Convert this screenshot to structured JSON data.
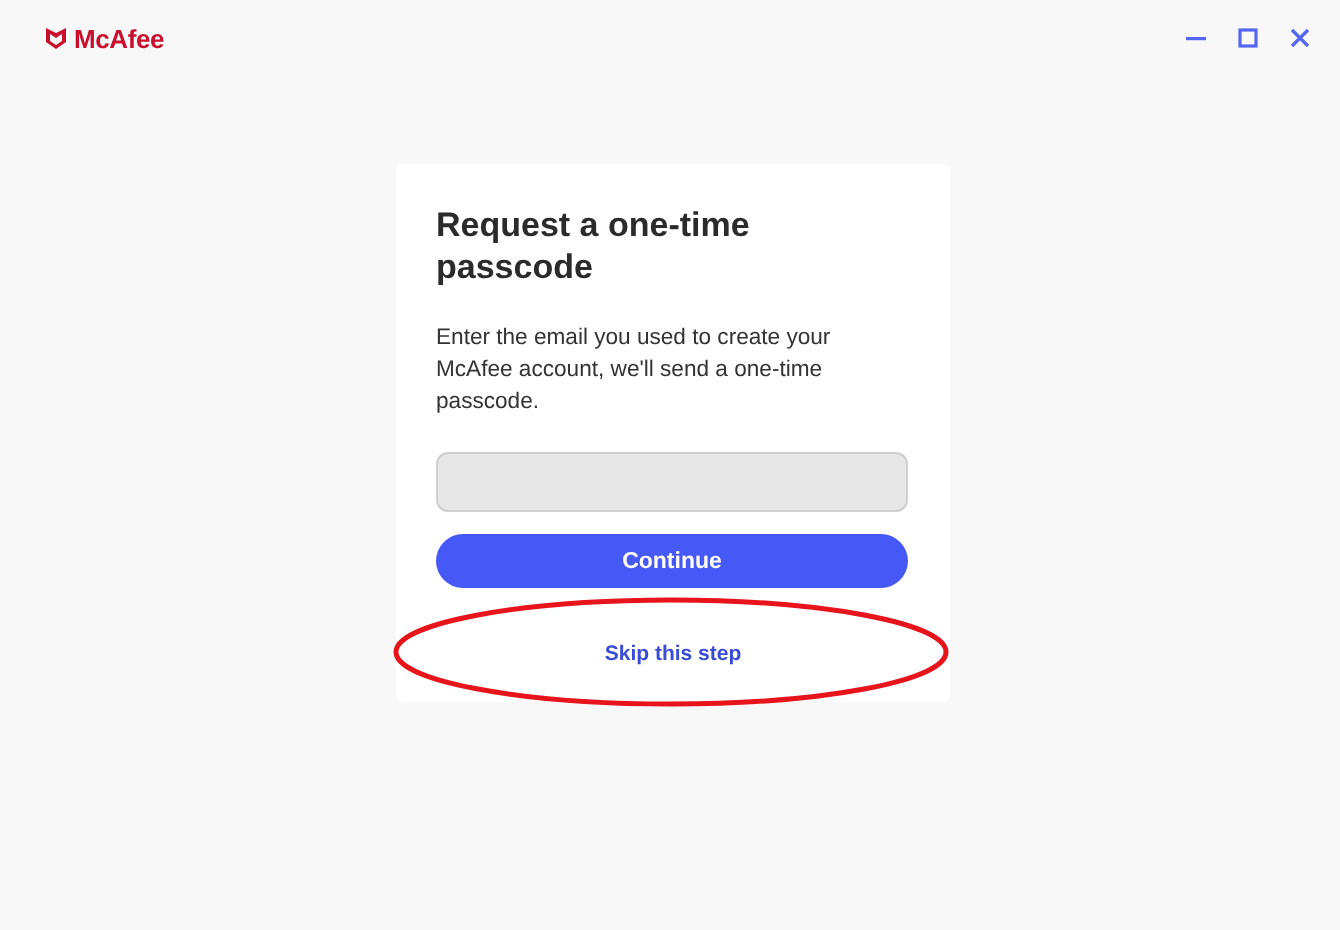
{
  "header": {
    "logo_text": "McAfee"
  },
  "card": {
    "title": "Request a one-time passcode",
    "description": "Enter the email you used to create your McAfee account, we'll send a one-time passcode.",
    "continue_button": "Continue",
    "skip_link": "Skip this step"
  },
  "highlight": {
    "kind": "ellipse"
  }
}
